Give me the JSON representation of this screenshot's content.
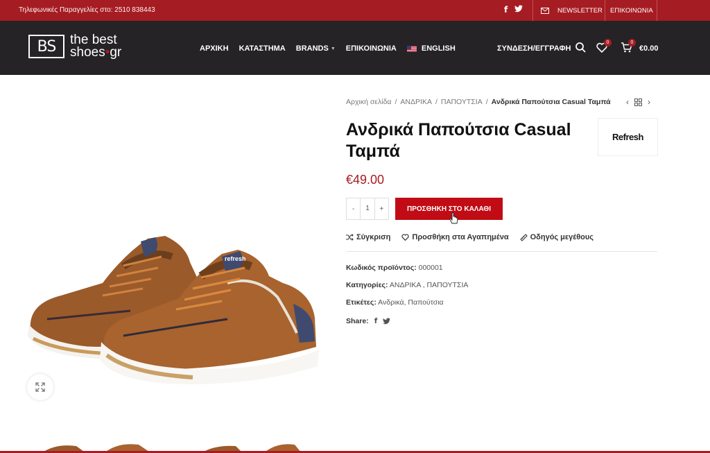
{
  "topbar": {
    "phone": "Τηλεφωνικές Παραγγελίες στο: 2510 838443",
    "social": [
      "f",
      "t"
    ],
    "newsletter": "NEWSLETTER",
    "contact": "ΕΠΙΚΟΙΝΩΝΙΑ"
  },
  "header": {
    "logo_mark": "BS",
    "logo_line1": "the best",
    "logo_line2_a": "shoes",
    "logo_dot": "•",
    "logo_line2_b": "gr",
    "nav": [
      {
        "label": "ΑΡΧΙΚΗ"
      },
      {
        "label": "ΚΑΤΑΣΤΗΜΑ"
      },
      {
        "label": "BRANDS"
      },
      {
        "label": "ΕΠΙΚΟΙΝΩΝΙΑ"
      },
      {
        "label": "ENGLISH"
      }
    ],
    "login": "ΣΥΝΔΕΣΗ/ΕΓΓΡΑΦΗ",
    "wishlist_count": "0",
    "cart_count": "0",
    "cart_total": "€0.00"
  },
  "product": {
    "breadcrumb": [
      "Αρχική σελίδα",
      "ΑΝΔΡΙΚΑ",
      "ΠΑΠΟΥΤΣΙΑ"
    ],
    "breadcrumb_sep": "/",
    "breadcrumb_current": "Ανδρικά Παπούτσια Casual Ταμπά",
    "title": "Ανδρικά Παπούτσια Casual Ταμπά",
    "brand": "Refresh",
    "price": "€49.00",
    "qty_minus": "-",
    "qty_value": "1",
    "qty_plus": "+",
    "add_to_cart": "ΠΡΟΣΘΗΚΗ ΣΤΟ ΚΑΛΑΘΙ",
    "compare": "Σύγκριση",
    "wishlist": "Προσθήκη στα Αγαπημένα",
    "size_guide": "Οδηγός μεγέθους",
    "sku_label": "Κωδικός προϊόντος:",
    "sku": "000001",
    "categories_label": "Κατηγορίες:",
    "categories": "ΑΝΔΡΙΚΑ , ΠΑΠΟΥΤΣΙΑ",
    "tags_label": "Ετικέτες:",
    "tags": "Ανδρικά, Παπούτσια",
    "share_label": "Share:",
    "shoe_logo_text": "refresh"
  },
  "colors": {
    "brand_red": "#a61c23",
    "header_dark": "#252325",
    "button_red": "#c10c15"
  }
}
